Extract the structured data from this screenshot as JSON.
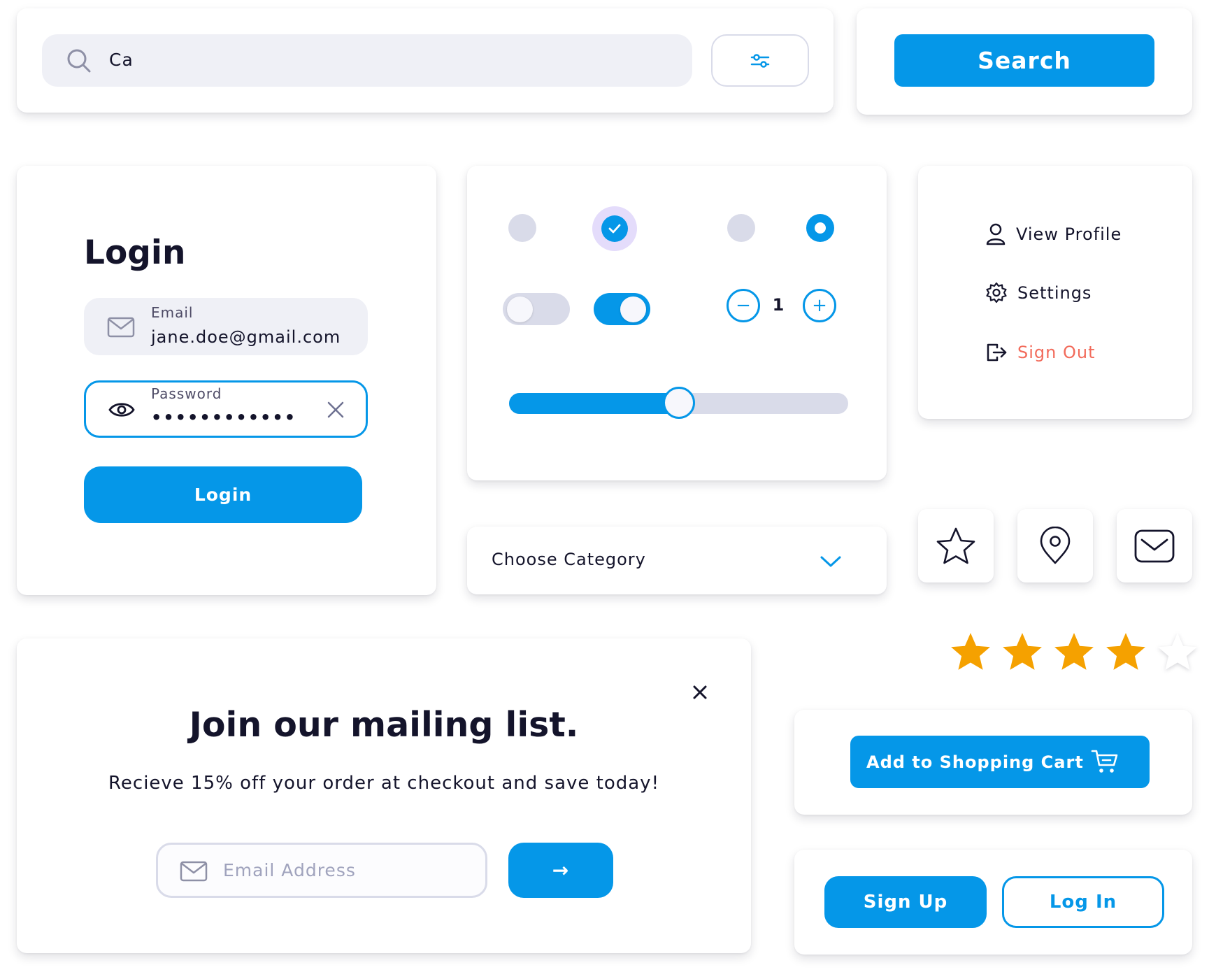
{
  "colors": {
    "accent": "#0597e8",
    "danger": "#f26b5b",
    "text_dark": "#14142b",
    "muted": "#d9dbe9",
    "input_bg": "#eff0f6",
    "star": "#f5a100"
  },
  "search_bar": {
    "query": "Ca",
    "icon": "search-icon",
    "filter_icon": "sliders-icon"
  },
  "search_button": {
    "label": "Search"
  },
  "login_form": {
    "title": "Login",
    "email_label": "Email",
    "email_value": "jane.doe@gmail.com",
    "password_label": "Password",
    "password_value": "••••••••••••",
    "submit_label": "Login"
  },
  "controls": {
    "radios": [
      {
        "state": "unchecked"
      },
      {
        "state": "checked"
      },
      {
        "state": "unchecked"
      },
      {
        "state": "selected"
      }
    ],
    "toggles": [
      {
        "on": false
      },
      {
        "on": true
      }
    ],
    "stepper": {
      "value": "1",
      "minus": "−",
      "plus": "+"
    },
    "slider": {
      "value_percent": 50
    }
  },
  "dropdown": {
    "selected": "Choose Category",
    "icon": "chevron-down-icon"
  },
  "profile_menu": {
    "items": [
      {
        "label": "View Profile",
        "icon": "user-icon"
      },
      {
        "label": "Settings",
        "icon": "gear-icon"
      },
      {
        "label": "Sign Out",
        "icon": "sign-out-icon"
      }
    ]
  },
  "icon_tiles": [
    "star-icon",
    "map-pin-icon",
    "mail-icon"
  ],
  "rating": {
    "value": 4,
    "max": 5
  },
  "mailing_list": {
    "title": "Join our mailing list.",
    "subtitle": "Recieve 15% off your order at checkout and save today!",
    "email_placeholder": "Email Address",
    "submit_arrow": "→"
  },
  "cart_button": {
    "label": "Add to Shopping Cart"
  },
  "auth_buttons": {
    "sign_up": "Sign Up",
    "log_in": "Log In"
  }
}
